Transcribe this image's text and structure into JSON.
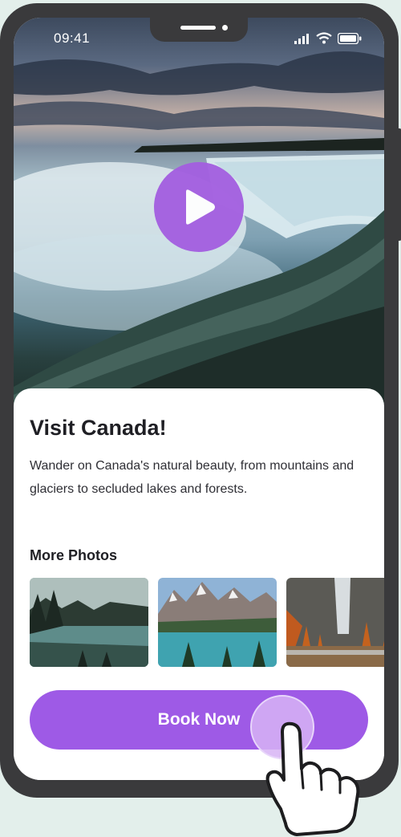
{
  "status_bar": {
    "time": "09:41",
    "signal_icon": "signal-icon",
    "wifi_icon": "wifi-icon",
    "battery_icon": "battery-icon"
  },
  "hero": {
    "play_icon": "play-icon",
    "accent_color": "#a35ee0"
  },
  "card": {
    "title": "Visit Canada!",
    "description": "Wander on Canada's natural beauty, from mountains and glaciers to secluded lakes and forests.",
    "more_photos_label": "More Photos",
    "photos": [
      {
        "subject": "forest-lake"
      },
      {
        "subject": "mountain-lake"
      },
      {
        "subject": "autumn-waterfall"
      }
    ],
    "book_button_label": "Book Now",
    "button_color": "#9e5ae6"
  },
  "overlay": {
    "hand_icon": "tap-hand-icon"
  }
}
